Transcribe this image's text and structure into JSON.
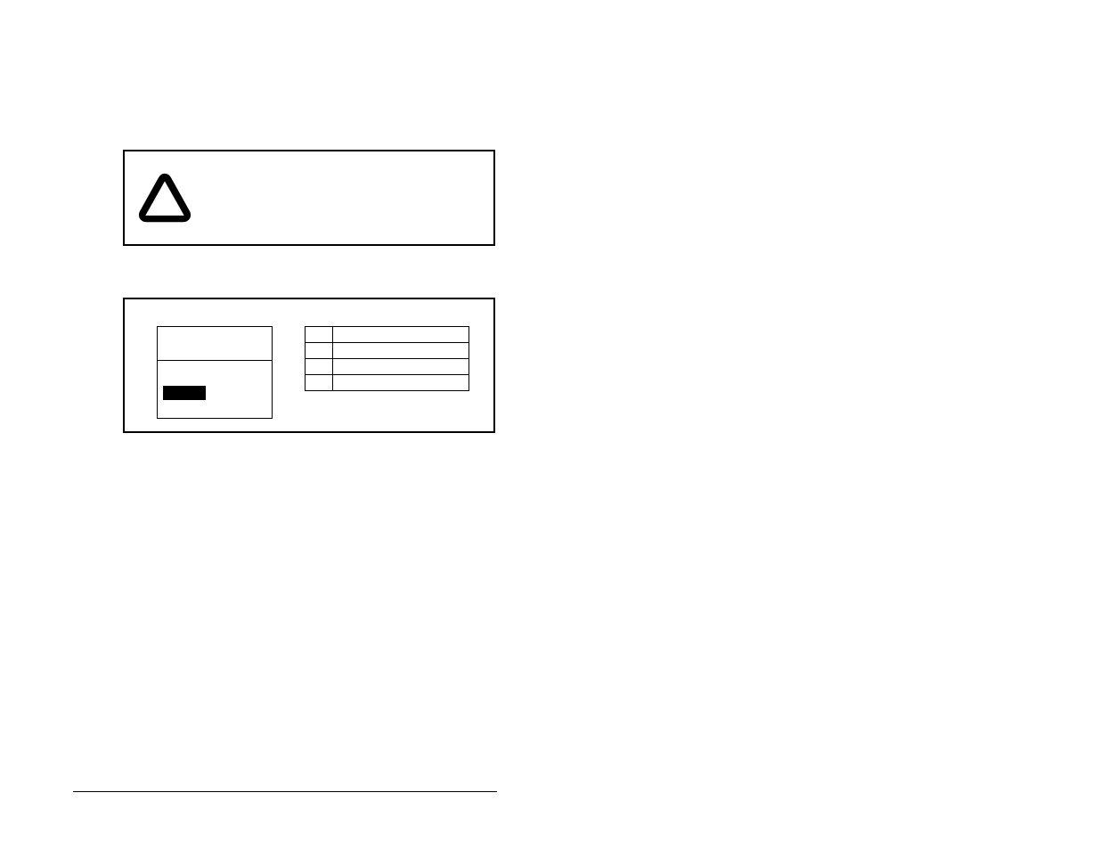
{
  "notice": {
    "icon_name": "warning-triangle-icon"
  },
  "nameplate": {
    "left_table": {
      "rows": 2,
      "black_block": true
    },
    "right_table": {
      "rows": [
        {
          "a": "",
          "b": ""
        },
        {
          "a": "",
          "b": ""
        },
        {
          "a": "",
          "b": ""
        },
        {
          "a": "",
          "b": ""
        }
      ]
    }
  }
}
